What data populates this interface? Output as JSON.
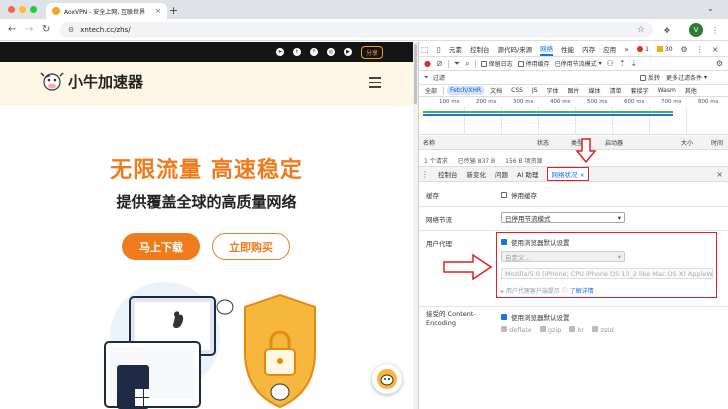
{
  "browser": {
    "tab_title": "AoxVPN - 安全上网, 互联世界",
    "new_tab": "+",
    "url": "xntech.cc/zhs/",
    "avatar_letter": "V"
  },
  "page": {
    "share_label": "分享",
    "brand_name": "小牛加速器",
    "hero_title": "无限流量 高速稳定",
    "hero_subtitle": "提供覆盖全球的高质量网络",
    "download_button": "马上下载",
    "buy_button": "立即购买",
    "accent_color": "#f07b1c"
  },
  "devtools": {
    "main_tabs": [
      "元素",
      "控制台",
      "源代码/来源",
      "网络",
      "性能",
      "内存",
      "应用"
    ],
    "active_main_tab": "网络",
    "issues_errors": "1",
    "issues_warnings": "30",
    "toolbar": {
      "preserve_log": "保留日志",
      "disable_cache": "停用缓存",
      "throttle": "已停用节流模式"
    },
    "filter": {
      "placeholder": "过滤",
      "invert": "反转",
      "more_filters": "更多过滤条件"
    },
    "types": [
      "全部",
      "Fetch/XHR",
      "文档",
      "CSS",
      "JS",
      "字体",
      "图片",
      "媒体",
      "清单",
      "套接字",
      "Wasm",
      "其他"
    ],
    "active_type": "Fetch/XHR",
    "timeline_ticks": [
      "100 ms",
      "200 ms",
      "300 ms",
      "400 ms",
      "500 ms",
      "600 ms",
      "700 ms",
      "800 ms"
    ],
    "columns": {
      "name": "名称",
      "status": "状态",
      "type": "类型",
      "initiator": "启动器",
      "size": "大小",
      "time": "时间"
    },
    "status_bar": {
      "requests": "1 个请求",
      "transferred": "已传输 837 B",
      "resources": "156 B 项资源"
    },
    "drawer_tabs": [
      "控制台",
      "新变化",
      "问题",
      "AI 助理",
      "网络状况"
    ],
    "active_drawer_tab": "网络状况",
    "conditions": {
      "cache_label": "缓存",
      "cache_value": "停用缓存",
      "throttling_label": "网络节流",
      "throttling_value": "已停用节流模式",
      "ua_label": "用户代理",
      "ua_default": "使用浏览器默认设置",
      "ua_custom_placeholder": "自定义...",
      "ua_string": "Mozilla/5.0 (iPhone; CPU iPhone OS 13_2 like Mac OS X) AppleWebKit/8",
      "ua_hints": "用户代理客户端提示",
      "ua_learn_more": "了解详情",
      "encoding_label": "接受的 Content-Encoding",
      "encoding_default": "使用浏览器默认设置",
      "encodings": [
        "deflate",
        "gzip",
        "br",
        "zstd"
      ]
    }
  }
}
